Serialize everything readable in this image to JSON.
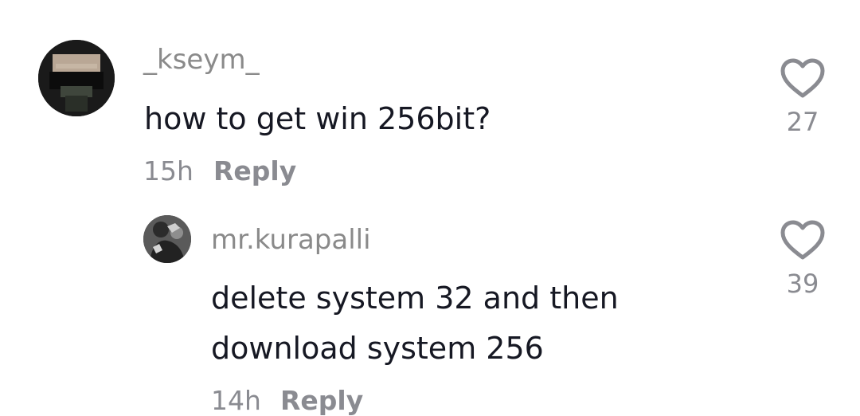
{
  "comments": [
    {
      "username": "_kseym_",
      "text": "how to get win 256bit?",
      "time": "15h",
      "reply_label": "Reply",
      "likes": "27",
      "like_icon": "heart-outline-icon"
    },
    {
      "username": "mr.kurapalli",
      "text_lines": [
        "delete system 32 and then",
        "download system 256"
      ],
      "time": "14h",
      "reply_label": "Reply",
      "likes": "39",
      "like_icon": "heart-outline-icon"
    }
  ],
  "colors": {
    "background": "#ffffff",
    "text_primary": "#161823",
    "text_secondary": "#8a8b91"
  }
}
